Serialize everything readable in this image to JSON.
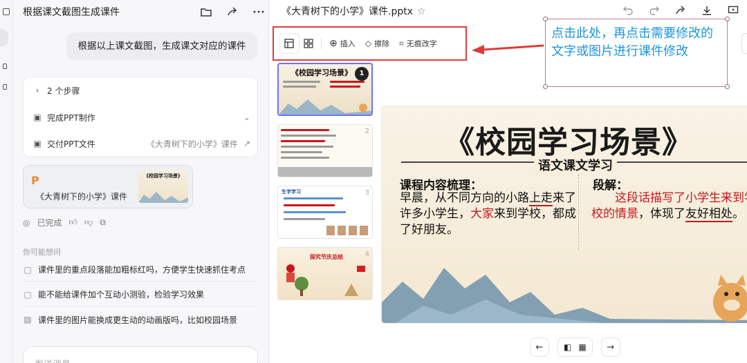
{
  "chat": {
    "title": "根据课文截图生成课件",
    "user_message": "根据以上课文截图，生成课文对应的课件",
    "steps_toggle": "2 个步骤",
    "steps": [
      {
        "label": "完成PPT制作",
        "right": ""
      },
      {
        "label": "交付PPT文件",
        "right": "《大青树下的小学》课件"
      }
    ],
    "file_card": {
      "icon_letter": "P",
      "name": "《大青树下的小学》课件",
      "thumb_title": "《校园学习场景》"
    },
    "status": "已完成",
    "suggest_heading": "你可能想问",
    "suggestions": [
      "课件里的重点段落能加粗标红吗，方便学生快速抓住考点",
      "能不能给课件加个互动小测验，检验学习效果",
      "课件里的图片能换成更生动的动画版吗，比如校园场景"
    ],
    "input_placeholder": "发送消息"
  },
  "document": {
    "title": "《大青树下的小学》课件.pptx",
    "star": "☆"
  },
  "toolbar": {
    "insert": "插入",
    "erase": "擦除",
    "no_trace_text": "无痕改字"
  },
  "thumbnails": [
    {
      "num": "1",
      "title": "《校园学习场景》"
    },
    {
      "num": "2",
      "title": ""
    },
    {
      "num": "3",
      "title": "生字学习"
    },
    {
      "num": "4",
      "title": "探究节庆总结"
    }
  ],
  "slide": {
    "title": "《校园学习场景》",
    "subtitle": "语文课文学习",
    "col1_heading": "课程内容梳理：",
    "col1_text_a": "早晨，从不同方向的小路",
    "col1_text_b": "上走",
    "col1_text_c": "来了许多小学生，",
    "col1_text_d": "大家",
    "col1_text_e": "来到学校，都成了好朋友。",
    "col2_heading": "段解：",
    "col2_text_a": "这段话描写了小学生来到学校的情景",
    "col2_text_b": "，体现了",
    "col2_text_c": "友好相处",
    "col2_text_d": "。"
  },
  "callout": {
    "text": "点击此处，再点击需要修改的文字或图片进行课件修改"
  },
  "colors": {
    "annotation_red": "#e03a3a",
    "callout_blue": "#1c95e0",
    "slide_red": "#c8161d",
    "file_icon_orange": "#f28a2c"
  }
}
